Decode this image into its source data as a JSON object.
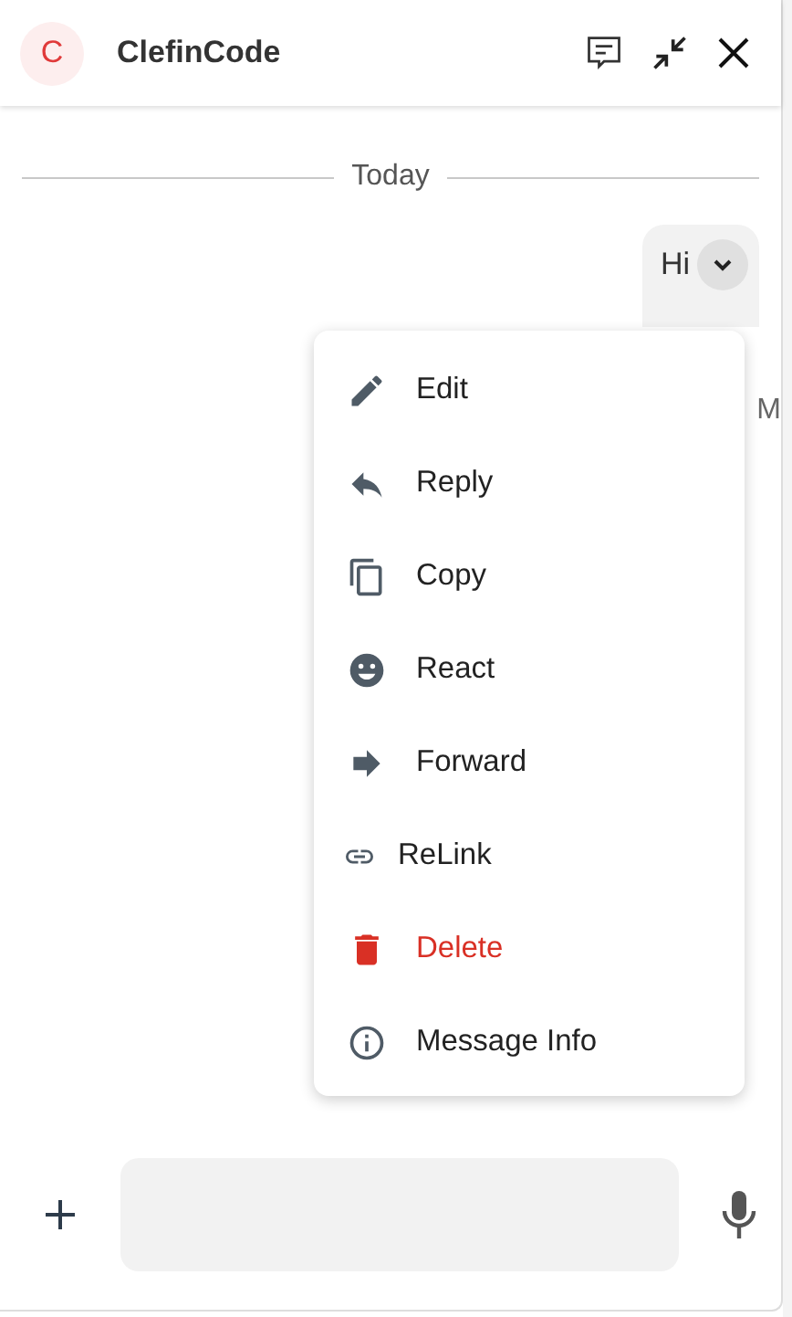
{
  "header": {
    "avatar": "C",
    "title": "ClefinCode"
  },
  "divider": {
    "label": "Today"
  },
  "message": {
    "text": "Hi",
    "time": "M"
  },
  "menu": [
    {
      "label": "Edit",
      "kind": "normal"
    },
    {
      "label": "Reply",
      "kind": "normal"
    },
    {
      "label": "Copy",
      "kind": "normal"
    },
    {
      "label": "React",
      "kind": "normal"
    },
    {
      "label": "Forward",
      "kind": "normal"
    },
    {
      "label": "ReLink",
      "kind": "normal"
    },
    {
      "label": "Delete",
      "kind": "danger"
    },
    {
      "label": "Message Info",
      "kind": "normal"
    }
  ]
}
